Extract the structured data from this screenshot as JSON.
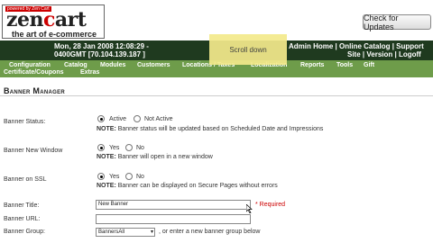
{
  "logo": {
    "badge": "powered by Zen Cart",
    "brand": "zencart",
    "tagline": "the art of e-commerce"
  },
  "header": {
    "check_updates": "Check for Updates",
    "date_line1": "Mon, 28 Jan 2008 12:08:29 -",
    "date_line2": "0400GMT [70.104.139.187 ]",
    "links_line1": "Admin Home | Online Catalog | Support",
    "links_line2": "Site | Version | Logoff"
  },
  "menu": {
    "configuration": "Configuration",
    "catalog": "Catalog",
    "modules": "Modules",
    "customers": "Customers",
    "locations": "Locations / Taxes",
    "localization": "Localization",
    "reports": "Reports",
    "tools": "Tools",
    "gift": "Gift",
    "certificate": "Certificate/Coupons",
    "extras": "Extras"
  },
  "tooltip": "Scroll down",
  "page_title": "Banner Manager",
  "form": {
    "status_label": "Banner Status:",
    "status_active": "Active",
    "status_inactive": "Not Active",
    "status_note_b": "NOTE:",
    "status_note": " Banner status will be updated based on Scheduled Date and Impressions",
    "window_label": "Banner New Window",
    "window_yes": "Yes",
    "window_no": "No",
    "window_note_b": "NOTE:",
    "window_note": " Banner will open in a new window",
    "ssl_label": "Banner on SSL",
    "ssl_yes": "Yes",
    "ssl_no": "No",
    "ssl_note_b": "NOTE:",
    "ssl_note": " Banner can be displayed on Secure Pages without errors",
    "title_label": "Banner Title:",
    "title_value": "New Banner",
    "required": "* Required",
    "url_label": "Banner URL:",
    "url_value": "",
    "group_label": "Banner Group:",
    "group_value": "BannersAll",
    "group_note": ", or enter a new banner group below"
  }
}
